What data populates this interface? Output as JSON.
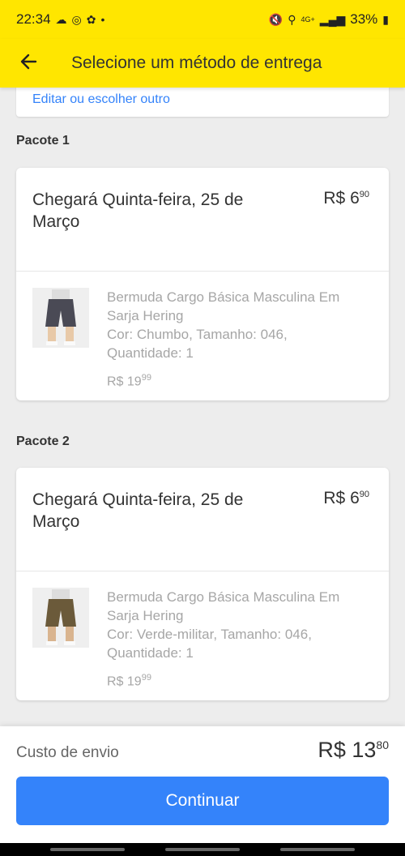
{
  "status_bar": {
    "time": "22:34",
    "battery": "33%",
    "network": "4G+"
  },
  "header": {
    "title": "Selecione um método de entrega",
    "back_icon": "arrow-left-icon"
  },
  "address": {
    "edit_link": "Editar ou escolher outro"
  },
  "packages": [
    {
      "label": "Pacote 1",
      "delivery": "Chegará Quinta-feira, 25 de Março",
      "shipping_price": "R$ 6",
      "shipping_cents": "90",
      "product_name": "Bermuda Cargo Básica Masculina Em Sarja Hering",
      "product_details": "Cor: Chumbo, Tamanho: 046, Quantidade: 1",
      "product_price": "R$ 19",
      "product_cents": "99",
      "product_color": "#4a4a55"
    },
    {
      "label": "Pacote 2",
      "delivery": "Chegará Quinta-feira, 25 de Março",
      "shipping_price": "R$ 6",
      "shipping_cents": "90",
      "product_name": "Bermuda Cargo Básica Masculina Em Sarja Hering",
      "product_details": "Cor: Verde-militar, Tamanho: 046, Quantidade: 1",
      "product_price": "R$ 19",
      "product_cents": "99",
      "product_color": "#6b5a3a"
    }
  ],
  "footer": {
    "shipping_label": "Custo de envio",
    "shipping_total": "R$ 13",
    "shipping_total_cents": "80",
    "continue_label": "Continuar"
  },
  "colors": {
    "brand_yellow": "#ffe600",
    "accent_blue": "#3483fa"
  }
}
